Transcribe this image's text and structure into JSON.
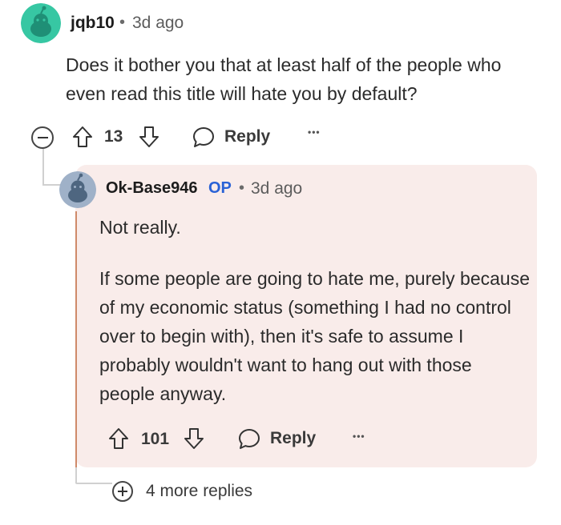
{
  "comment": {
    "username": "jqb10",
    "separator": "•",
    "timestamp": "3d ago",
    "body": "Does it bother you that at least half of the people who even read this title will hate you by default?",
    "upvotes": "13",
    "reply_label": "Reply",
    "more_label": "•••",
    "avatar_color": "#37c7a3"
  },
  "reply": {
    "username": "Ok-Base946",
    "op_badge": "OP",
    "separator": "•",
    "timestamp": "3d ago",
    "paragraph1": "Not really.",
    "paragraph2": "If some people are going to hate me, purely because of my economic status (something I had no control over to begin with), then it's safe to assume I probably wouldn't want to hang out with those people anyway.",
    "upvotes": "101",
    "reply_label": "Reply",
    "more_label": "•••",
    "avatar_color": "#7a8fa8",
    "card_color": "#f9ecea"
  },
  "more_replies_label": "4 more replies"
}
